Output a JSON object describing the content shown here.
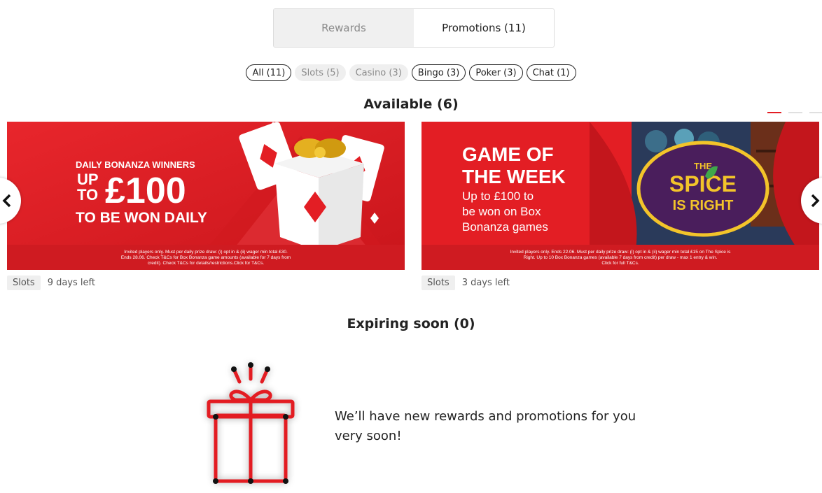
{
  "tabs": [
    {
      "label": "Rewards",
      "active": false
    },
    {
      "label": "Promotions (11)",
      "active": true
    }
  ],
  "filters": [
    {
      "label": "All (11)",
      "style": "outline"
    },
    {
      "label": "Slots (5)",
      "style": "muted"
    },
    {
      "label": "Casino (3)",
      "style": "muted"
    },
    {
      "label": "Bingo (3)",
      "style": "outline"
    },
    {
      "label": "Poker (3)",
      "style": "outline"
    },
    {
      "label": "Chat (1)",
      "style": "outline"
    }
  ],
  "available": {
    "title": "Available (6)",
    "cards": [
      {
        "banner_lines": [
          "DAILY BONANZA WINNERS",
          "UP",
          "TO",
          "£100",
          "TO BE WON DAILY"
        ],
        "fine_print": [
          "Invited players only. Must per daily prize draw: (i) opt in & (ii) wager min total £30.",
          "Ends 28.06. Check T&Cs for Box Bonanza game amounts (available for 7 days from",
          "credit). Check T&Cs for details/restrictions.Click for T&Cs."
        ],
        "tag": "Slots",
        "days_left": "9 days left"
      },
      {
        "banner_lines": [
          "GAME OF",
          "THE WEEK",
          "Up to £100 to",
          "be won on Box",
          "Bonanza games"
        ],
        "logo_lines": [
          "THE",
          "SPICE",
          "IS RIGHT"
        ],
        "fine_print": [
          "Invited players only. Ends 22.06. Must per daily prize draw: (i) opt in & (ii) wager min total £15 on The Spice is",
          "Right. Up to 10 Box Bonanza games (available 7 days from credit) per draw - max 1 entry & win.",
          "Click for full T&Cs."
        ],
        "tag": "Slots",
        "days_left": "3 days left"
      }
    ]
  },
  "expiring": {
    "title": "Expiring soon (0)",
    "empty_message": "We’ll have new rewards and promotions for you very soon!"
  },
  "colors": {
    "brand_red": "#e31e24",
    "muted_bg": "#efefef"
  },
  "icons": {
    "prev": "chevron-left-icon",
    "next": "chevron-right-icon",
    "empty": "gift-box-icon"
  }
}
